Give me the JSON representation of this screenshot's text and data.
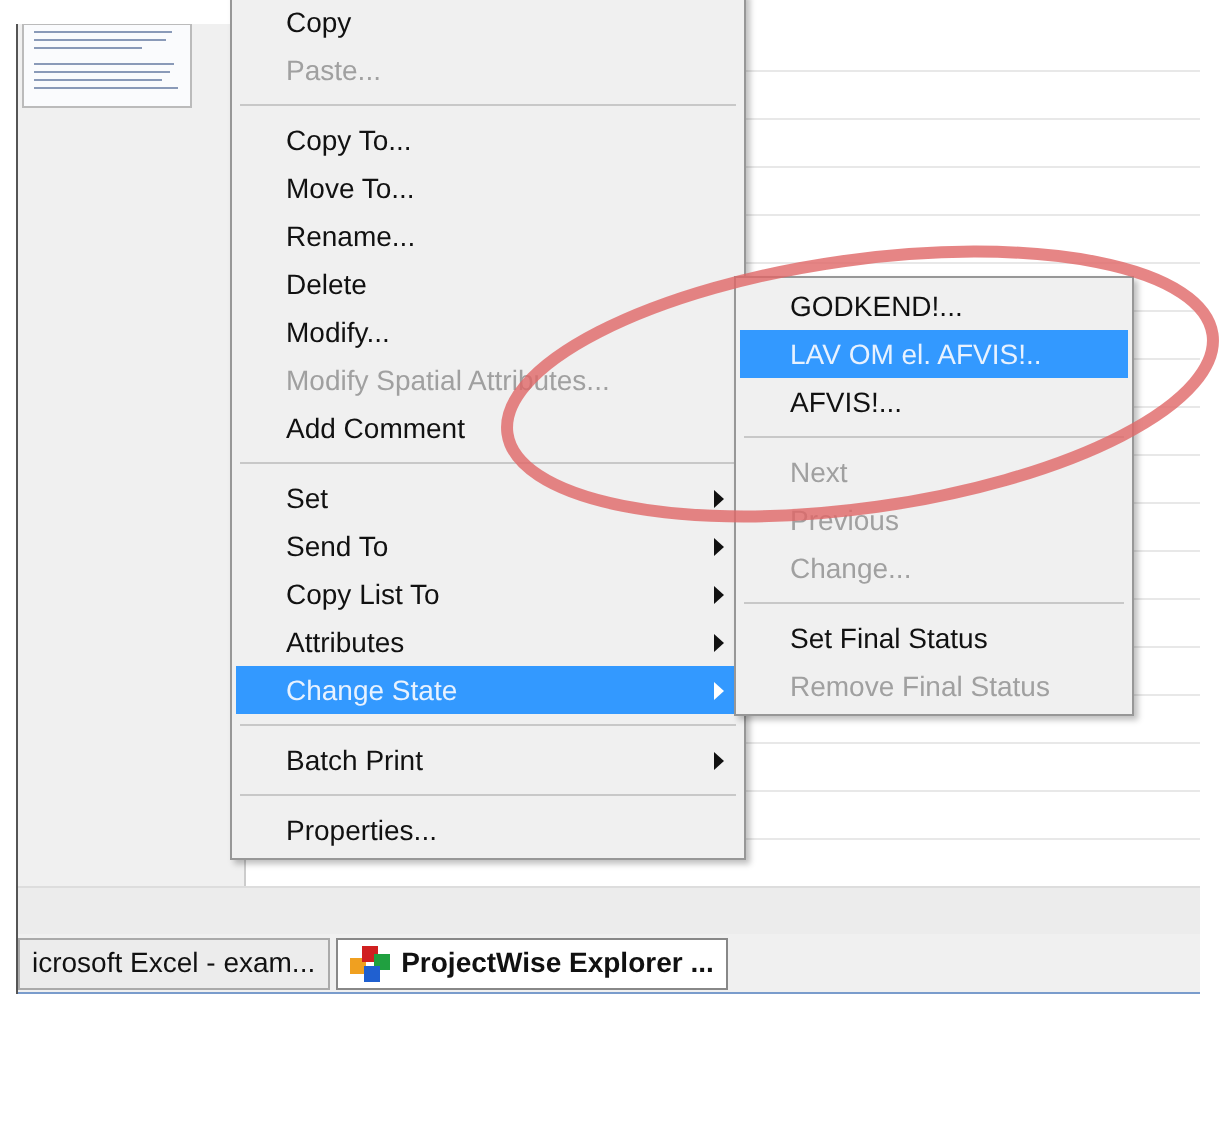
{
  "context_menu": {
    "items": [
      {
        "kind": "item",
        "label": "Copy",
        "disabled": false,
        "submenu": false,
        "selected": false
      },
      {
        "kind": "item",
        "label": "Paste...",
        "disabled": true,
        "submenu": false,
        "selected": false
      },
      {
        "kind": "separator"
      },
      {
        "kind": "item",
        "label": "Copy To...",
        "disabled": false,
        "submenu": false,
        "selected": false
      },
      {
        "kind": "item",
        "label": "Move To...",
        "disabled": false,
        "submenu": false,
        "selected": false
      },
      {
        "kind": "item",
        "label": "Rename...",
        "disabled": false,
        "submenu": false,
        "selected": false
      },
      {
        "kind": "item",
        "label": "Delete",
        "disabled": false,
        "submenu": false,
        "selected": false
      },
      {
        "kind": "item",
        "label": "Modify...",
        "disabled": false,
        "submenu": false,
        "selected": false
      },
      {
        "kind": "item",
        "label": "Modify Spatial Attributes...",
        "disabled": true,
        "submenu": false,
        "selected": false
      },
      {
        "kind": "item",
        "label": "Add Comment",
        "disabled": false,
        "submenu": false,
        "selected": false
      },
      {
        "kind": "separator"
      },
      {
        "kind": "item",
        "label": "Set",
        "disabled": false,
        "submenu": true,
        "selected": false
      },
      {
        "kind": "item",
        "label": "Send To",
        "disabled": false,
        "submenu": true,
        "selected": false
      },
      {
        "kind": "item",
        "label": "Copy List To",
        "disabled": false,
        "submenu": true,
        "selected": false
      },
      {
        "kind": "item",
        "label": "Attributes",
        "disabled": false,
        "submenu": true,
        "selected": false
      },
      {
        "kind": "item",
        "label": "Change State",
        "disabled": false,
        "submenu": true,
        "selected": true
      },
      {
        "kind": "separator"
      },
      {
        "kind": "item",
        "label": "Batch Print",
        "disabled": false,
        "submenu": true,
        "selected": false
      },
      {
        "kind": "separator"
      },
      {
        "kind": "item",
        "label": "Properties...",
        "disabled": false,
        "submenu": false,
        "selected": false
      }
    ]
  },
  "submenu": {
    "items": [
      {
        "kind": "item",
        "label": "GODKEND!...",
        "disabled": false,
        "selected": false
      },
      {
        "kind": "item",
        "label": "LAV OM el. AFVIS!..",
        "disabled": false,
        "selected": true
      },
      {
        "kind": "item",
        "label": "AFVIS!...",
        "disabled": false,
        "selected": false
      },
      {
        "kind": "separator"
      },
      {
        "kind": "item",
        "label": "Next",
        "disabled": true,
        "selected": false
      },
      {
        "kind": "item",
        "label": "Previous",
        "disabled": true,
        "selected": false
      },
      {
        "kind": "item",
        "label": "Change...",
        "disabled": true,
        "selected": false
      },
      {
        "kind": "separator"
      },
      {
        "kind": "item",
        "label": "Set Final Status",
        "disabled": false,
        "selected": false
      },
      {
        "kind": "item",
        "label": "Remove Final Status",
        "disabled": true,
        "selected": false
      }
    ]
  },
  "taskbar": {
    "buttons": [
      {
        "label": "icrosoft Excel - exam...",
        "selected": false,
        "icon": false
      },
      {
        "label": "ProjectWise Explorer ...",
        "selected": true,
        "icon": true
      }
    ]
  }
}
